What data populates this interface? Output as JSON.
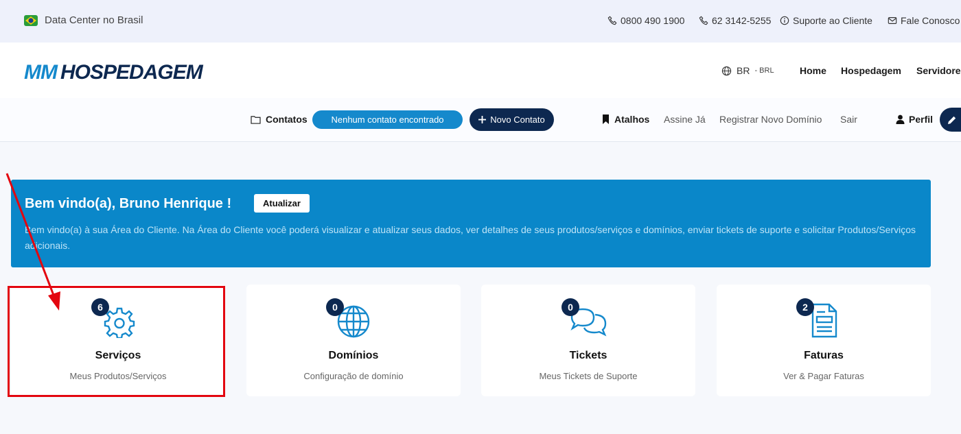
{
  "topbar": {
    "datacenter": "Data Center no Brasil",
    "phone1": "0800 490 1900",
    "phone2": "62 3142-5255",
    "support": "Suporte ao Cliente",
    "contact": "Fale Conosco"
  },
  "header": {
    "logo_text": "MMHOSPEDAGEM",
    "lang": "BR",
    "currency": "- BRL",
    "nav": [
      "Home",
      "Hospedagem",
      "Servidore"
    ]
  },
  "subbar": {
    "contatos_label": "Contatos",
    "no_contact": "Nenhum contato encontrado",
    "new_contact": "Novo Contato",
    "atalhos_label": "Atalhos",
    "links": [
      "Assine Já",
      "Registrar Novo Domínio",
      "Sair"
    ],
    "perfil": "Perfil"
  },
  "banner": {
    "welcome": "Bem vindo(a), Bruno Henrique !",
    "refresh": "Atualizar",
    "description": "Bem vindo(a) à sua Área do Cliente. Na Área do Cliente você poderá visualizar e atualizar seus dados, ver detalhes de seus produtos/serviços e domínios, enviar tickets de suporte e solicitar Produtos/Serviços adicionais."
  },
  "cards": [
    {
      "count": "6",
      "title": "Serviços",
      "subtitle": "Meus Produtos/Serviços",
      "icon": "gear-icon"
    },
    {
      "count": "0",
      "title": "Domínios",
      "subtitle": "Configuração de domínio",
      "icon": "globe-icon"
    },
    {
      "count": "0",
      "title": "Tickets",
      "subtitle": "Meus Tickets de Suporte",
      "icon": "chat-icon"
    },
    {
      "count": "2",
      "title": "Faturas",
      "subtitle": "Ver & Pagar Faturas",
      "icon": "invoice-icon"
    }
  ],
  "colors": {
    "accent": "#0a87c9",
    "dark": "#0d2850",
    "icon": "#1589cc",
    "highlight": "#e3060f"
  }
}
